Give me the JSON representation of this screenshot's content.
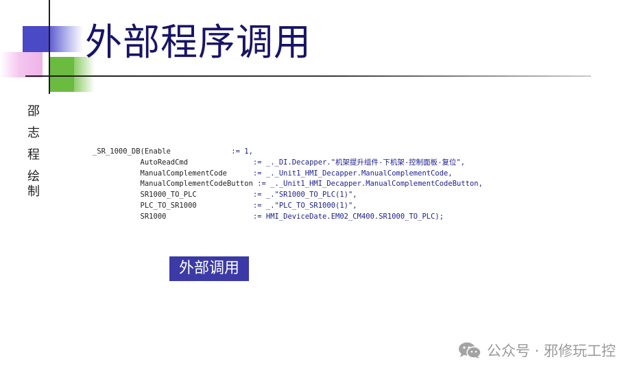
{
  "slide": {
    "title": "外部程序调用",
    "author": "邵 志 程 绘制"
  },
  "code": [
    {
      "lhs": "_SR_1000_DB(Enable              ",
      "rhs": ":= 1,"
    },
    {
      "lhs": "           AutoReadCmd               ",
      "rhs": ":= _._DI.Decapper.\"机架提升组件-下机架-控制面板-复位\","
    },
    {
      "lhs": "           ManualComplementCode      ",
      "rhs": ":= _._Unit1_HMI_Decapper.ManualComplementCode,"
    },
    {
      "lhs": "           ManualComplementCodeButton ",
      "rhs": ":= _._Unit1_HMI_Decapper.ManualComplementCodeButton,"
    },
    {
      "lhs": "           SR1000_TO_PLC             ",
      "rhs": ":= _.\"SR1000_TO_PLC(1)\","
    },
    {
      "lhs": "           PLC_TO_SR1000             ",
      "rhs": ":= _.\"PLC_TO_SR1000(1)\","
    },
    {
      "lhs": "           SR1000                    ",
      "rhs": ":= HMI_DeviceDate.EM02_CM400.SR1000_TO_PLC);"
    }
  ],
  "button": {
    "label": "外部调用"
  },
  "watermark": {
    "text": "公众号 · 邪修玩工控",
    "icon": "wechat-icon"
  },
  "colors": {
    "title": "#171466",
    "button_bg": "#3b3aa6",
    "deco_blue": "#4a49c6",
    "deco_green": "#6abb3f",
    "deco_pink": "#eeb3e8"
  }
}
